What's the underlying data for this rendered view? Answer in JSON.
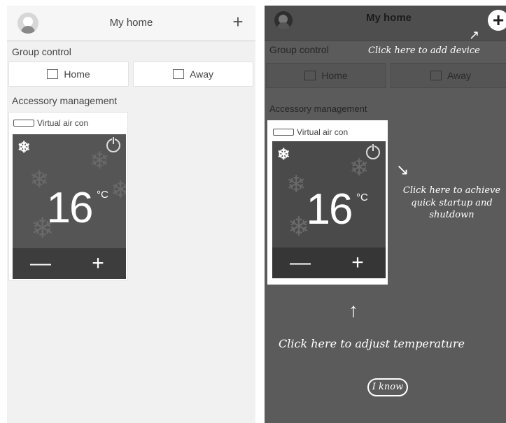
{
  "left": {
    "header": {
      "title": "My home",
      "add_icon": "plus-icon"
    },
    "group_control": {
      "label": "Group control",
      "home": "Home",
      "away": "Away"
    },
    "accessory": {
      "label": "Accessory management"
    },
    "device": {
      "name": "Virtual air con",
      "temperature": "16",
      "unit": "°C",
      "minus": "—",
      "plus": "+"
    }
  },
  "right": {
    "header": {
      "title": "My home",
      "add_icon": "plus-circle-icon"
    },
    "group_control": {
      "label": "Group control",
      "home": "Home",
      "away": "Away"
    },
    "accessory": {
      "label": "Accessory management"
    },
    "device": {
      "name": "Virtual air con",
      "temperature": "16",
      "unit": "°C",
      "minus": "—",
      "plus": "+"
    },
    "hints": {
      "add_device": "Click here to add device",
      "power_line1": "Click here to achieve",
      "power_line2": "quick startup and",
      "power_line3": "shutdown",
      "temperature": "Click here to adjust temperature",
      "iknow": "I know"
    }
  }
}
